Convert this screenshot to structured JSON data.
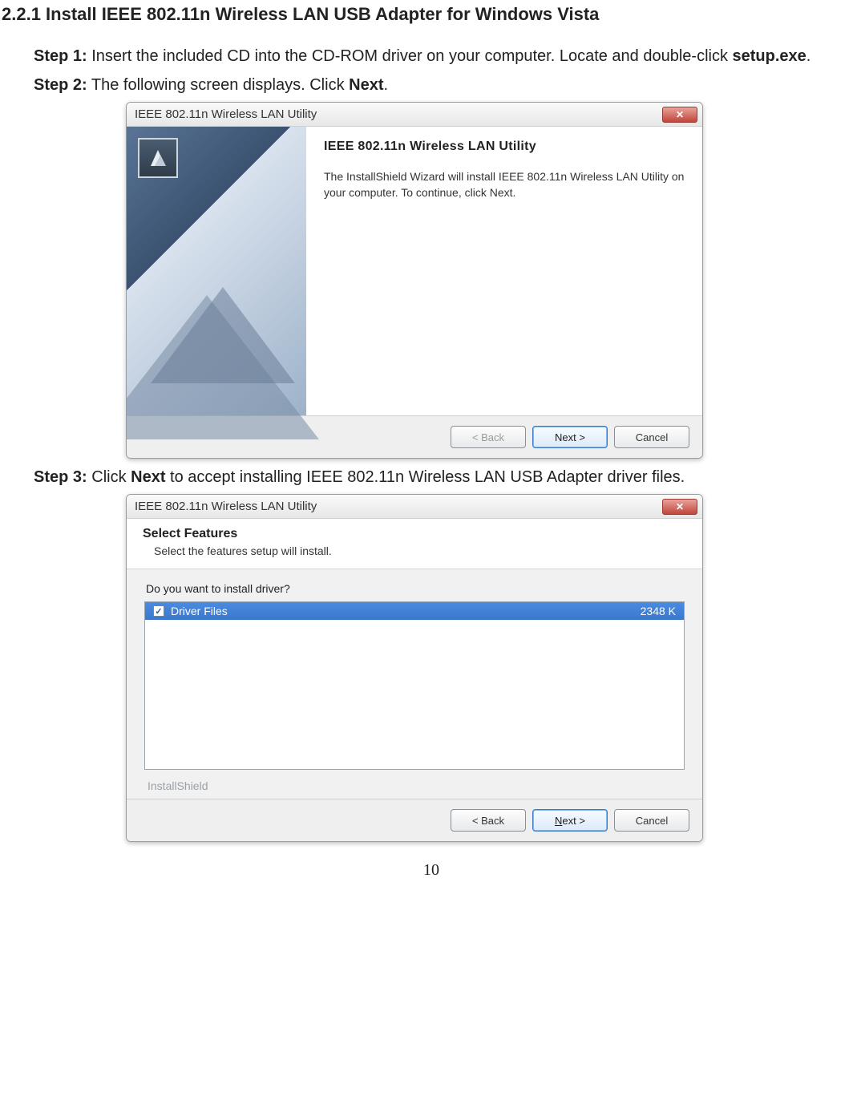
{
  "heading": "2.2.1 Install IEEE 802.11n Wireless LAN USB Adapter for Windows Vista",
  "step1": {
    "label": "Step 1:",
    "text_a": " Insert the included CD into the CD-ROM driver on your computer. Locate and double-click ",
    "bold": "setup.exe",
    "text_b": "."
  },
  "step2": {
    "label": "Step 2:",
    "text_a": " The following screen displays. Click ",
    "bold": "Next",
    "text_b": "."
  },
  "step3": {
    "label": "Step 3:",
    "text_a": " Click ",
    "bold": "Next",
    "text_b": " to accept installing IEEE 802.11n Wireless LAN USB Adapter driver files."
  },
  "dialog1": {
    "title": "IEEE 802.11n Wireless LAN Utility",
    "heading": "IEEE  802.11n Wireless LAN Utility",
    "body": "The InstallShield Wizard will install IEEE 802.11n Wireless LAN Utility on your computer.  To continue, click Next.",
    "back": "< Back",
    "next": "Next >",
    "cancel": "Cancel"
  },
  "dialog2": {
    "title": "IEEE 802.11n Wireless LAN Utility",
    "features_title": "Select Features",
    "features_sub": "Select the features setup will install.",
    "question": "Do you want to install driver?",
    "item_label": "Driver Files",
    "item_size": "2348 K",
    "ishield": "InstallShield",
    "back": "< Back",
    "next_pre": "N",
    "next_post": "ext >",
    "cancel": "Cancel"
  },
  "page": "10"
}
